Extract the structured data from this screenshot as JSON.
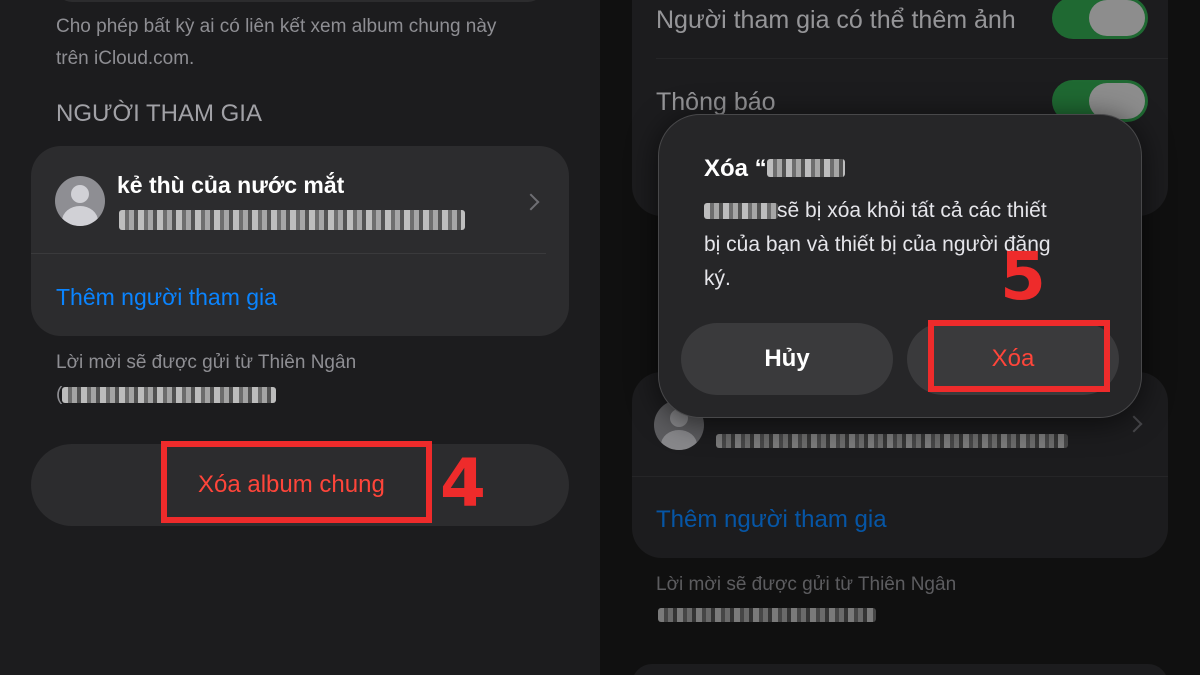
{
  "left": {
    "share_desc_line1": "Cho phép bất kỳ ai có liên kết xem album chung này",
    "share_desc_line2": "trên iCloud.com.",
    "section_header": "NGƯỜI THAM GIA",
    "participant_name": "kẻ thù của nước mắt",
    "add_participant": "Thêm người tham gia",
    "invite_note": "Lời mời sẽ được gửi từ Thiên Ngân",
    "invite_paren": "(",
    "delete_album": "Xóa album chung",
    "step_number": "4"
  },
  "right": {
    "participants_can_add": "Người tham gia có thể thêm ảnh",
    "notifications": "Thông báo",
    "add_participant": "Thêm người tham gia",
    "invite_note": "Lời mời sẽ được gửi từ Thiên Ngân",
    "dialog": {
      "title_prefix": "Xóa “",
      "message_suffix": " sẽ bị xóa khỏi tất cả các thiết",
      "message_line2": "bị của bạn và thiết bị của người đăng",
      "message_line3": "ký.",
      "cancel": "Hủy",
      "delete": "Xóa"
    },
    "step_number": "5"
  },
  "colors": {
    "background": "#1c1c1e",
    "card": "#2c2c2e",
    "link_blue": "#0a84ff",
    "destructive_red": "#ff453a",
    "annotation_red": "#ee2b2b",
    "toggle_green": "#30a14e"
  }
}
